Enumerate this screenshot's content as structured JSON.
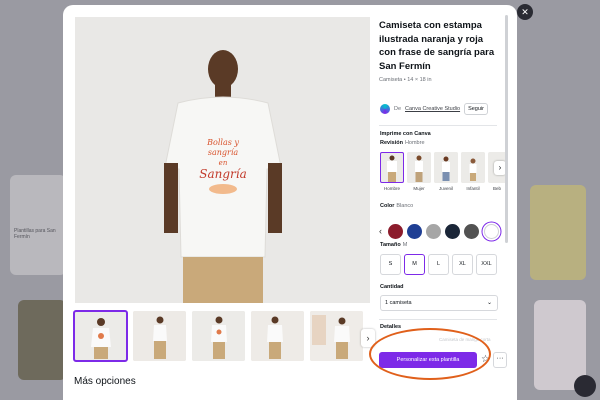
{
  "product": {
    "title": "Camiseta con estampa ilustrada naranja y roja con frase de sangría para San Fermín",
    "subtitle": "Camiseta • 14 × 18 in",
    "creator_prefix": "De",
    "creator_name": "Canva Creative Studio",
    "follow_label": "Seguir"
  },
  "print": {
    "heading": "Imprime con Canva",
    "revision_label": "Revisión",
    "revision_value": "Hombre",
    "styles": [
      {
        "label": "Hombre",
        "selected": true
      },
      {
        "label": "Mujer"
      },
      {
        "label": "Juvenil"
      },
      {
        "label": "Infantil"
      },
      {
        "label": "Beb"
      }
    ],
    "styles_next_glyph": "›"
  },
  "color": {
    "label": "Color",
    "value": "Blanco",
    "prev_glyph": "‹",
    "swatches": [
      "#8c1c2c",
      "#1f3f94",
      "#a6a6a6",
      "#1b2638",
      "#525252",
      "#ffffff"
    ]
  },
  "size": {
    "label": "Tamaño",
    "value": "M",
    "options": [
      "S",
      "M",
      "L",
      "XL",
      "XXL"
    ]
  },
  "quantity": {
    "label": "Cantidad",
    "value": "1 camiseta",
    "chevron": "⌄"
  },
  "details": {
    "label": "Detalles",
    "hidden_text": "Camiseta de manga corta"
  },
  "actions": {
    "customize_label": "Personalizar esta plantilla",
    "star_glyph": "☆",
    "more_glyph": "···"
  },
  "gallery": {
    "next_glyph": "›",
    "thumb_count": 5
  },
  "more_options": "Más opciones",
  "close_glyph": "✕",
  "shirt_print": {
    "line1": "Bollas y",
    "line2": "sangría",
    "line3": "en",
    "line4": "Sangría"
  },
  "background": {
    "left_caption": "Plantillas para San Fermín"
  }
}
